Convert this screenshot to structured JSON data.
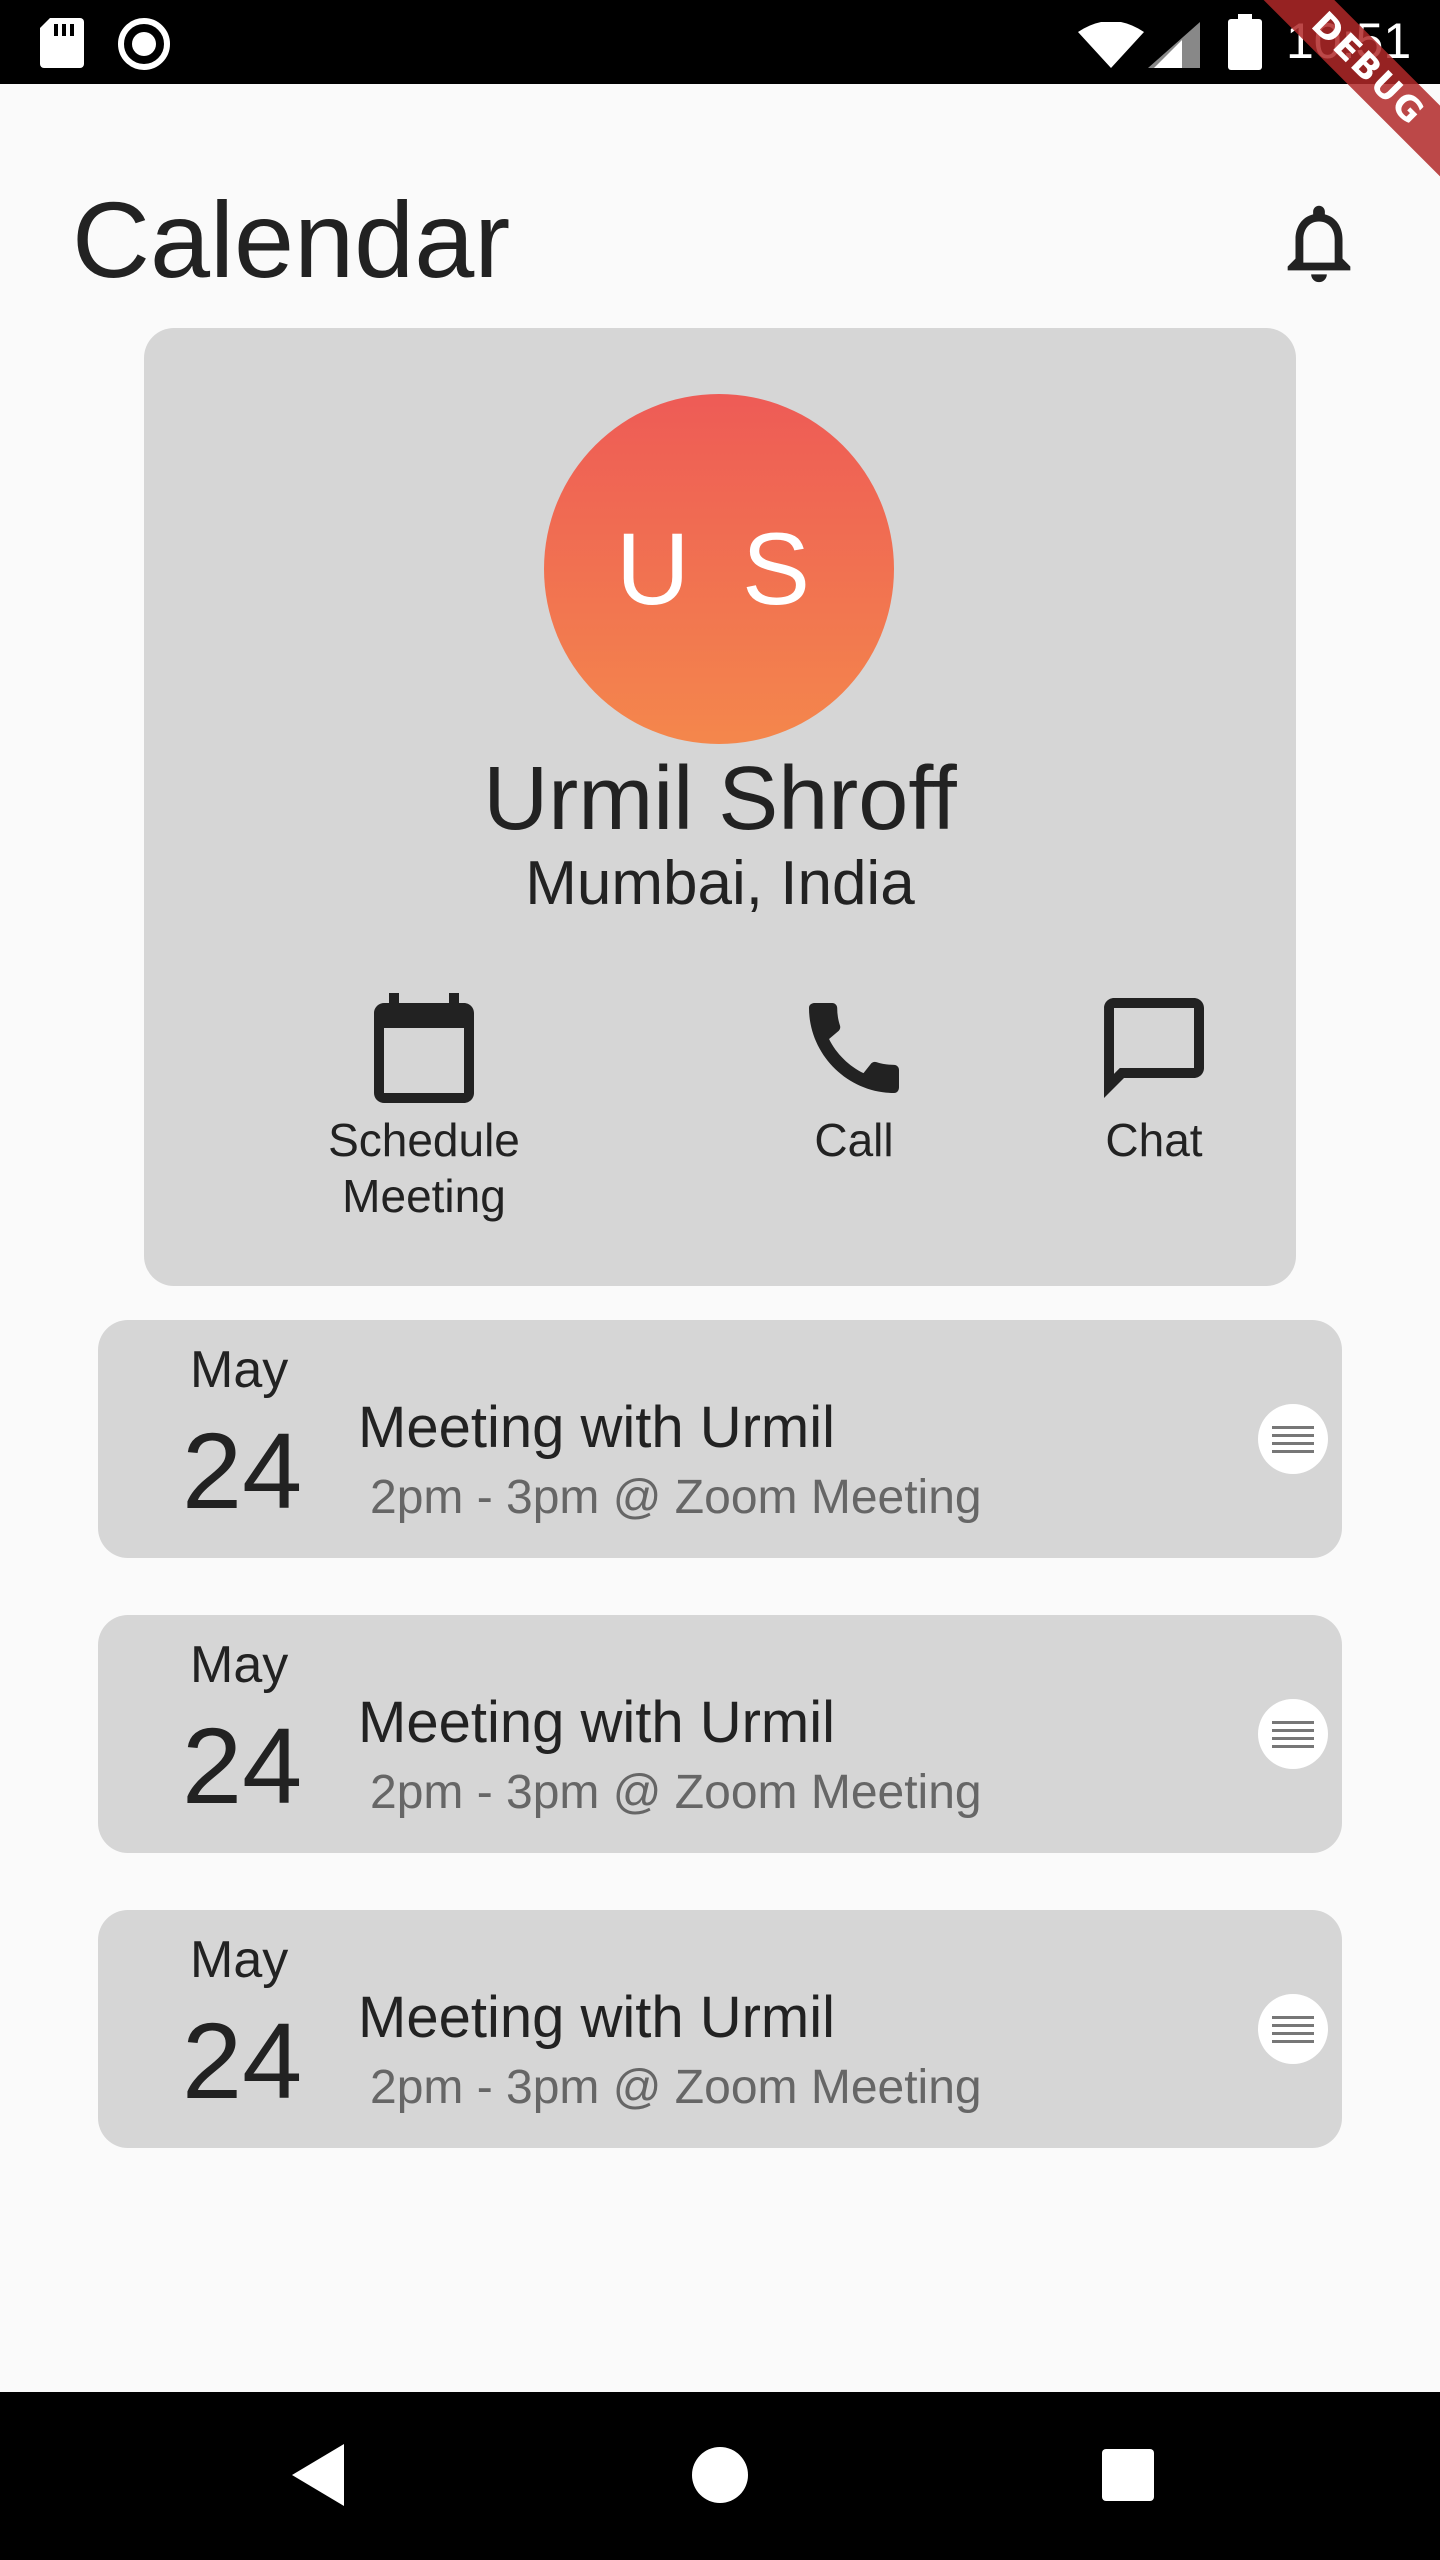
{
  "status_bar": {
    "time": "10:51",
    "debug_label": "DEBUG",
    "icons": [
      "sd-card-icon",
      "record-icon",
      "wifi-icon",
      "signal-icon",
      "battery-icon"
    ]
  },
  "header": {
    "title": "Calendar",
    "notification_icon": "bell-icon"
  },
  "profile": {
    "initials": "U S",
    "name": "Urmil Shroff",
    "location": "Mumbai, India",
    "avatar_gradient": [
      "#ee5b56",
      "#f4874c"
    ],
    "actions": [
      {
        "label_line1": "Schedule",
        "label_line2": "Meeting",
        "icon": "calendar-icon"
      },
      {
        "label": "Call",
        "icon": "phone-icon"
      },
      {
        "label": "Chat",
        "icon": "chat-icon"
      }
    ]
  },
  "meetings": [
    {
      "month": "May",
      "day": "24",
      "title": "Meeting with Urmil",
      "details": "2pm - 3pm @ Zoom Meeting"
    },
    {
      "month": "May",
      "day": "24",
      "title": "Meeting with Urmil",
      "details": "2pm - 3pm @ Zoom Meeting"
    },
    {
      "month": "May",
      "day": "24",
      "title": "Meeting with Urmil",
      "details": "2pm - 3pm @ Zoom Meeting"
    }
  ],
  "nav_bar": {
    "buttons": [
      "back-icon",
      "home-icon",
      "recent-apps-icon"
    ]
  },
  "colors": {
    "background": "#fafafa",
    "card": "#d6d6d6",
    "text": "#222222",
    "subtext": "#666666"
  }
}
